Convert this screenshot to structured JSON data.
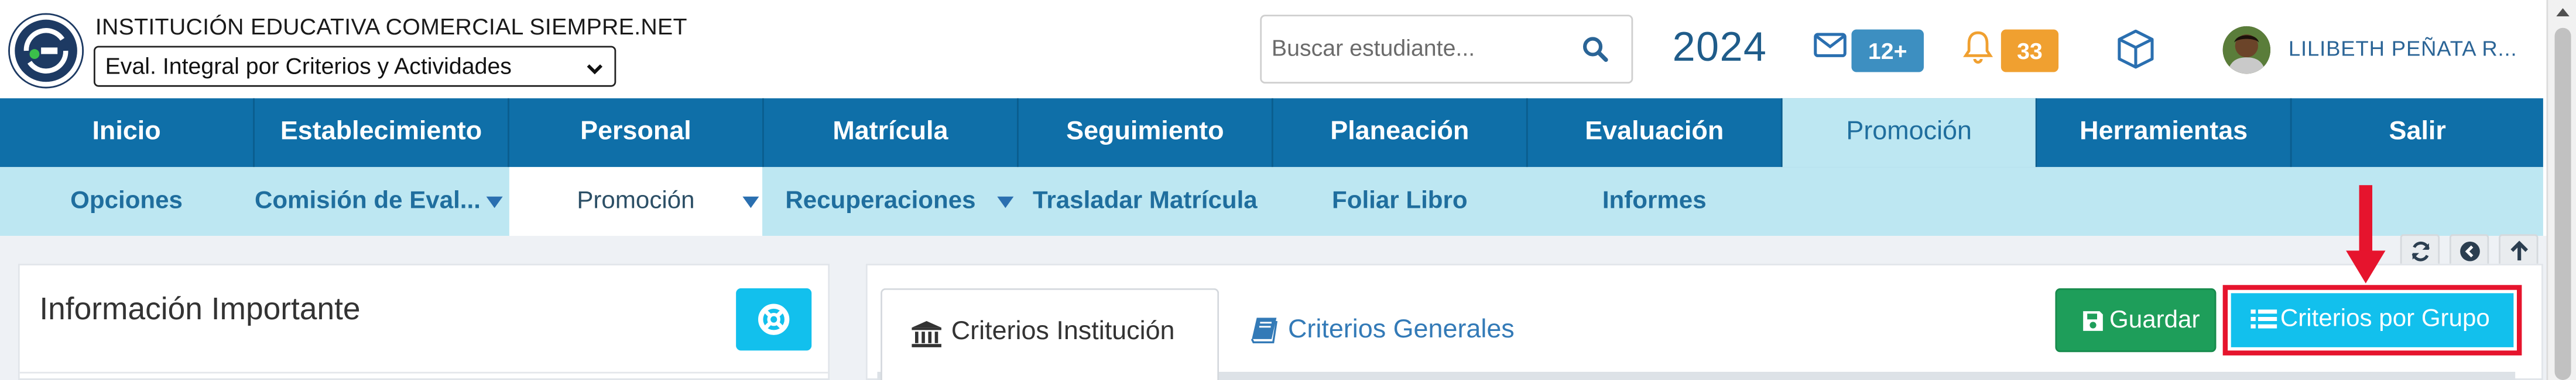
{
  "header": {
    "institution_name": "INSTITUCIÓN EDUCATIVA COMERCIAL SIEMPRE.NET",
    "period_selected": "Eval. Integral por Criterios y Actividades",
    "search_placeholder": "Buscar estudiante...",
    "year": "2024",
    "messages_badge": "12+",
    "notifications_badge": "33",
    "user_name": "LILIBETH PEÑATA R..."
  },
  "main_nav": {
    "items": [
      "Inicio",
      "Establecimiento",
      "Personal",
      "Matrícula",
      "Seguimiento",
      "Planeación",
      "Evaluación",
      "Promoción",
      "Herramientas",
      "Salir"
    ],
    "active": "Promoción"
  },
  "sub_nav": {
    "items": [
      "Opciones",
      "Comisión de Eval...",
      "Promoción",
      "Recuperaciones",
      "Trasladar Matrícula",
      "Foliar Libro",
      "Informes"
    ],
    "active": "Promoción"
  },
  "left_panel": {
    "title": "Información Importante"
  },
  "right_panel": {
    "tabs": [
      "Criterios Institución",
      "Criterios Generales"
    ],
    "active_tab": "Criterios Institución",
    "save_label": "Guardar",
    "criteria_by_group_label": "Criterios por Grupo"
  },
  "icons": {
    "search": "search-icon",
    "messages": "envelope-icon",
    "notifications": "bell-icon",
    "modules": "cube-icon",
    "help": "life-ring-icon",
    "institution_tab": "bank-icon",
    "general_tab": "book-icon",
    "save": "floppy-disk-icon",
    "criteria_by_group": "list-icon",
    "refresh": "refresh-icon",
    "back": "chevron-circle-left-icon",
    "up": "arrow-up-icon"
  },
  "colors": {
    "nav_bg": "#0f6fa8",
    "subnav_bg": "#bde7f2",
    "badge_messages": "#3d8fc1",
    "badge_notifications": "#f0a030",
    "save_button": "#1e9e5a",
    "info_button": "#12c0ed",
    "annotation": "#e6142d"
  }
}
